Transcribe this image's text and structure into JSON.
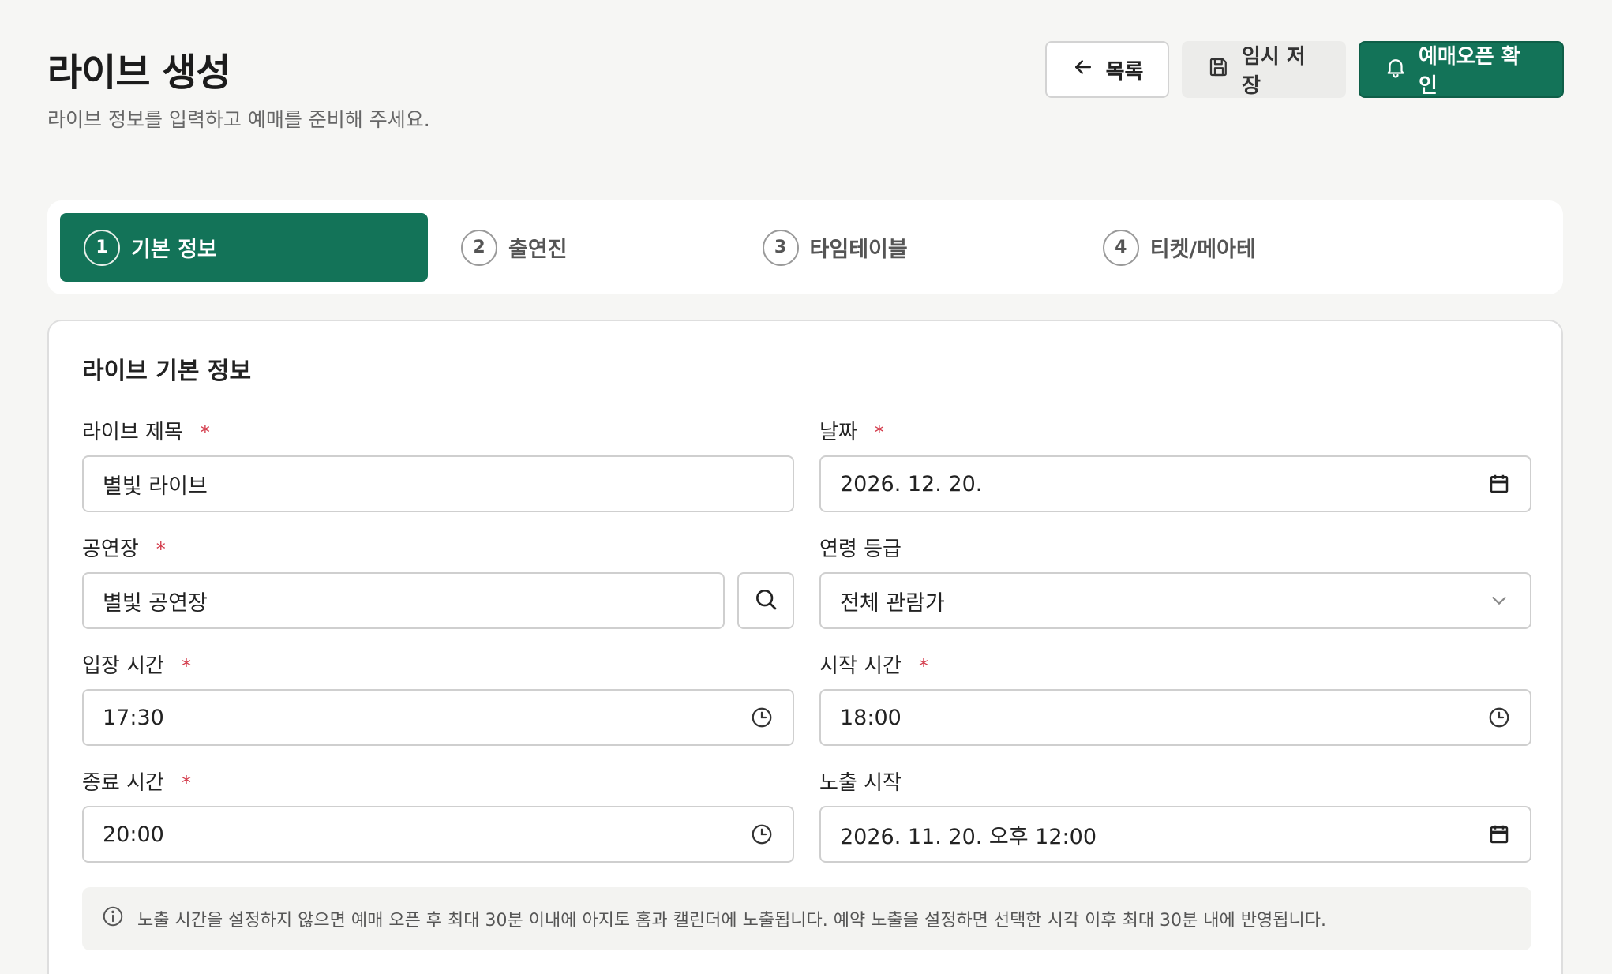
{
  "header": {
    "title": "라이브 생성",
    "subtitle": "라이브 정보를 입력하고 예매를 준비해 주세요.",
    "buttons": {
      "list_label": "목록",
      "draft_label": "임시 저장",
      "open_label": "예매오픈 확인"
    }
  },
  "stepper": {
    "steps": [
      {
        "num": "1",
        "label": "기본 정보",
        "active": true
      },
      {
        "num": "2",
        "label": "출연진",
        "active": false
      },
      {
        "num": "3",
        "label": "타임테이블",
        "active": false
      },
      {
        "num": "4",
        "label": "티켓/메아테",
        "active": false
      }
    ]
  },
  "form": {
    "section_title": "라이브 기본 정보",
    "required_mark": "*",
    "fields": {
      "title": {
        "label": "라이브 제목",
        "value": "별빛 라이브",
        "required": true
      },
      "date": {
        "label": "날짜",
        "value": "2026. 12. 20.",
        "required": true,
        "icon": "calendar-icon"
      },
      "venue": {
        "label": "공연장",
        "value": "별빛 공연장",
        "required": true,
        "icon": "search-icon"
      },
      "age_rating": {
        "label": "연령 등급",
        "value": "전체 관람가",
        "required": false,
        "icon": "chevron-down-icon"
      },
      "entry_time": {
        "label": "입장 시간",
        "value": "17:30",
        "required": true,
        "icon": "clock-icon"
      },
      "start_time": {
        "label": "시작 시간",
        "value": "18:00",
        "required": true,
        "icon": "clock-icon"
      },
      "end_time": {
        "label": "종료 시간",
        "value": "20:00",
        "required": true,
        "icon": "clock-icon"
      },
      "exposure_start": {
        "label": "노출 시작",
        "value": "2026. 11. 20. 오후 12:00",
        "required": false,
        "icon": "calendar-icon"
      }
    },
    "notice": "노출 시간을 설정하지 않으면 예매 오픈 후 최대 30분 이내에 아지토 홈과 캘린더에 노출됩니다. 예약 노출을 설정하면 선택한 시각 이후 최대 30분 내에 반영됩니다."
  },
  "colors": {
    "primary": "#137358",
    "required": "#d33a4a",
    "background": "#f6f6f4",
    "border": "#cfcfcf"
  }
}
